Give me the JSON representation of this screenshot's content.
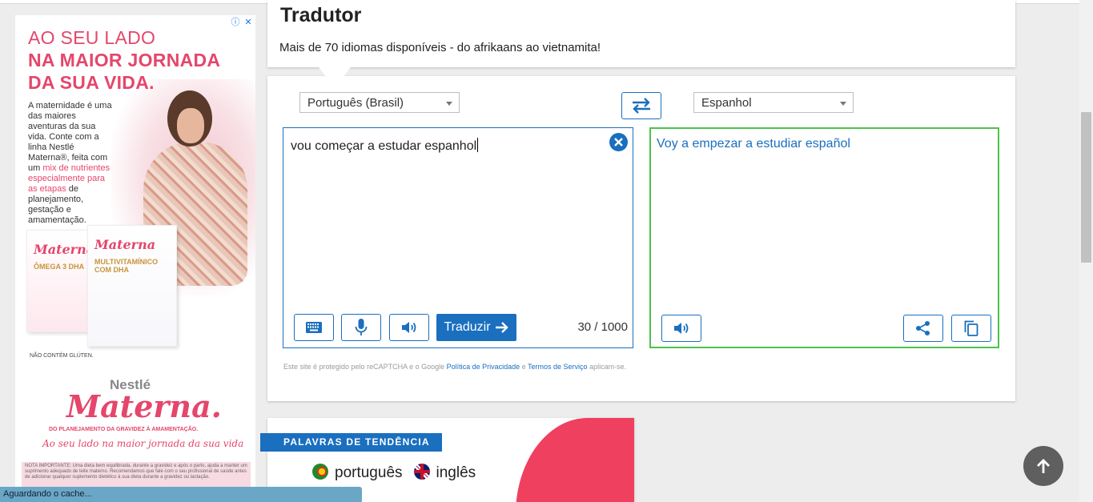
{
  "ad": {
    "headline_1": "AO SEU LADO",
    "headline_2": "NA MAIOR JORNADA",
    "headline_3": "DA SUA VIDA.",
    "body_1": "A maternidade é uma das maiores aventuras da sua vida. Conte com a linha Nestlé Materna®, feita com um ",
    "body_highlight": "mix de nutrientes especialmente para as etapas",
    "body_2": " de planejamento, gestação e amamentação.",
    "box1_brand": "Materna",
    "box1_sub": "ÔMEGA 3 DHA",
    "box2_brand": "Materna",
    "box2_sub": "MULTIVITAMÍNICO COM DHA",
    "gluten": "NÃO CONTÉM GLÚTEN.",
    "nestle": "Nestlé",
    "logo": "Materna.",
    "tagline_1": "DO PLANEJAMENTO DA GRAVIDEZ À AMAMENTAÇÃO.",
    "tagline_2": "Ao seu lado na maior jornada da sua vida",
    "note": "NOTA IMPORTANTE: Uma dieta bem equilibrada, durante a gravidez e após o parto, ajuda a manter um suprimento adequado de leite materno. Recomendamos que fale com o seu profissional de saúde antes de adicionar qualquer suplemento dietético à sua dieta durante a gravidez ou lactação."
  },
  "status_bar": "Aguardando o cache...",
  "header": {
    "title": "Tradutor",
    "subtitle": "Mais de 70 idiomas disponíveis - do afrikaans ao vietnamita!"
  },
  "translator": {
    "source_language": "Português (Brasil)",
    "target_language": "Espanhol",
    "source_text": "vou começar a estudar espanhol",
    "translated_text": "Voy a empezar a estudiar español",
    "translate_label": "Traduzir",
    "counter": "30 / 1000",
    "legal_prefix": "Este site é protegido pelo reCAPTCHA e o Google ",
    "privacy_link": "Política de Privacidade",
    "legal_and": " e ",
    "terms_link": "Termos de Serviço",
    "legal_suffix": " aplicam-se."
  },
  "trending": {
    "label": "PALAVRAS DE TENDÊNCIA",
    "lang_1": "português",
    "lang_2": "inglês"
  },
  "icons": {
    "swap": "swap-arrows-icon",
    "clear": "close-icon",
    "keyboard": "keyboard-icon",
    "mic": "microphone-icon",
    "speaker": "speaker-icon",
    "share": "share-icon",
    "copy": "copy-icon",
    "up": "arrow-up-icon"
  },
  "colors": {
    "accent": "#1a6fbf",
    "target_border": "#4cc34c",
    "ad_pink": "#e5466b",
    "trend_red": "#ef405f"
  }
}
